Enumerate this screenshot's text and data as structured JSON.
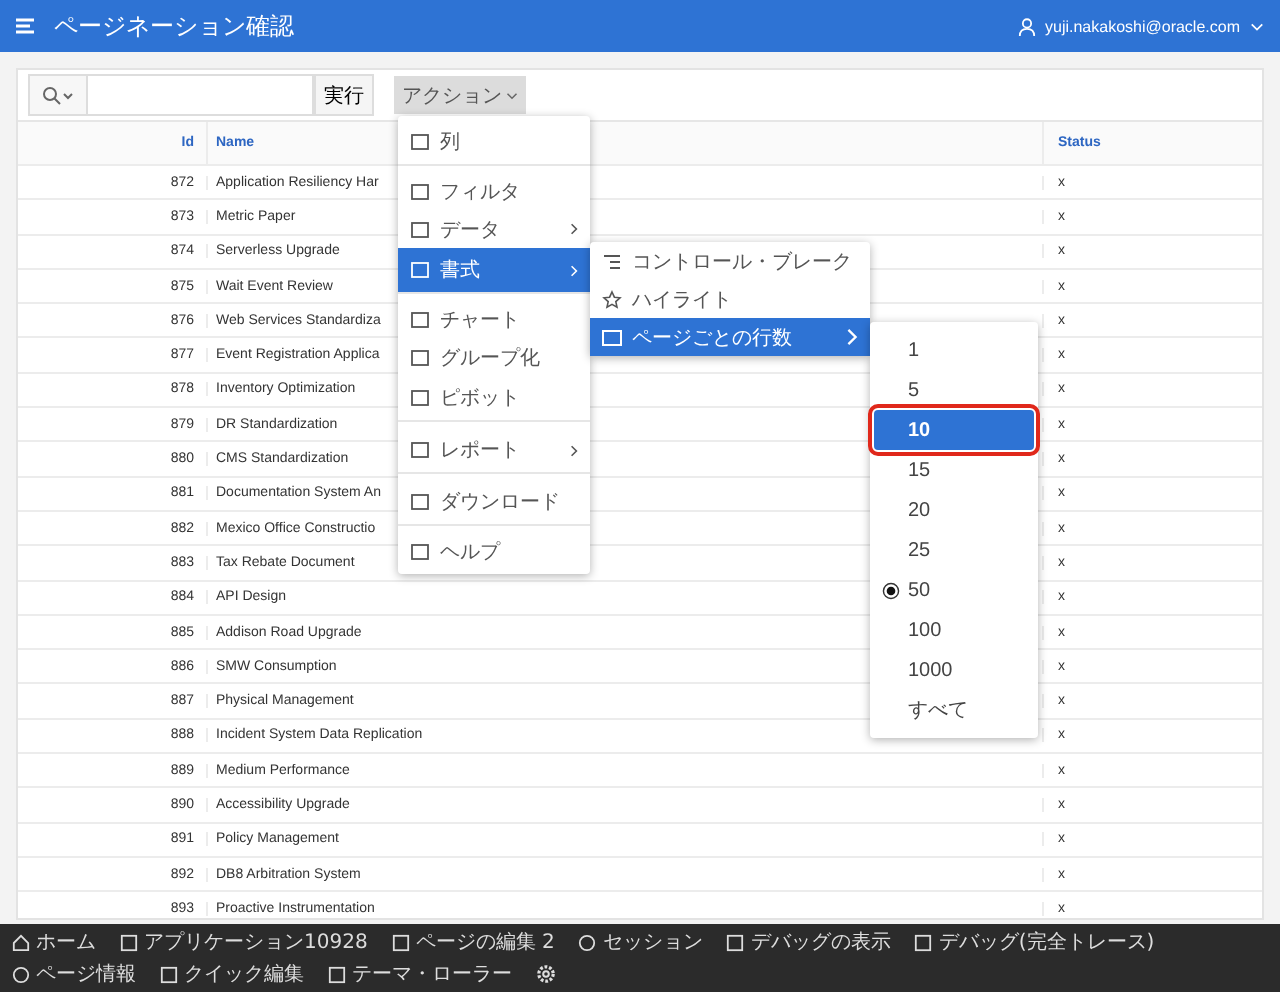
{
  "header": {
    "title": "ページネーション確認",
    "user": "yuji.nakakoshi@oracle.com"
  },
  "toolbar": {
    "go_button": "実行",
    "actions_button": "アクション"
  },
  "table": {
    "columns": [
      "Id",
      "Name",
      "Status"
    ],
    "rows": [
      {
        "id": "872",
        "name": "Application Resiliency Har",
        "status": "x"
      },
      {
        "id": "873",
        "name": "Metric Paper",
        "status": "x"
      },
      {
        "id": "874",
        "name": "Serverless Upgrade",
        "status": "x"
      },
      {
        "id": "875",
        "name": "Wait Event Review",
        "status": "x"
      },
      {
        "id": "876",
        "name": "Web Services Standardiza",
        "status": "x"
      },
      {
        "id": "877",
        "name": "Event Registration Applica",
        "status": "x"
      },
      {
        "id": "878",
        "name": "Inventory Optimization",
        "status": "x"
      },
      {
        "id": "879",
        "name": "DR Standardization",
        "status": "x"
      },
      {
        "id": "880",
        "name": "CMS Standardization",
        "status": "x"
      },
      {
        "id": "881",
        "name": "Documentation System An",
        "status": "x"
      },
      {
        "id": "882",
        "name": "Mexico Office Constructio",
        "status": "x"
      },
      {
        "id": "883",
        "name": "Tax Rebate Document",
        "status": "x"
      },
      {
        "id": "884",
        "name": "API Design",
        "status": "x"
      },
      {
        "id": "885",
        "name": "Addison Road Upgrade",
        "status": "x"
      },
      {
        "id": "886",
        "name": "SMW Consumption",
        "status": "x"
      },
      {
        "id": "887",
        "name": "Physical Management",
        "status": "x"
      },
      {
        "id": "888",
        "name": "Incident System Data Replication",
        "status": "x"
      },
      {
        "id": "889",
        "name": "Medium Performance",
        "status": "x"
      },
      {
        "id": "890",
        "name": "Accessibility Upgrade",
        "status": "x"
      },
      {
        "id": "891",
        "name": "Policy Management",
        "status": "x"
      },
      {
        "id": "892",
        "name": "DB8 Arbitration System",
        "status": "x"
      },
      {
        "id": "893",
        "name": "Proactive Instrumentation",
        "status": "x"
      }
    ]
  },
  "actions_menu": [
    {
      "label": "列",
      "submenu": false,
      "selected": false,
      "divider_after": true
    },
    {
      "label": "フィルタ",
      "submenu": false,
      "selected": false,
      "divider_after": false
    },
    {
      "label": "データ",
      "submenu": true,
      "selected": false,
      "divider_after": false
    },
    {
      "label": "書式",
      "submenu": true,
      "selected": true,
      "divider_after": true
    },
    {
      "label": "チャート",
      "submenu": false,
      "selected": false,
      "divider_after": false
    },
    {
      "label": "グループ化",
      "submenu": false,
      "selected": false,
      "divider_after": false
    },
    {
      "label": "ピボット",
      "submenu": false,
      "selected": false,
      "divider_after": true
    },
    {
      "label": "レポート",
      "submenu": true,
      "selected": false,
      "divider_after": true
    },
    {
      "label": "ダウンロード",
      "submenu": false,
      "selected": false,
      "divider_after": true
    },
    {
      "label": "ヘルプ",
      "submenu": false,
      "selected": false,
      "divider_after": false
    }
  ],
  "format_menu": [
    {
      "label": "コントロール・ブレーク",
      "submenu": false,
      "selected": false
    },
    {
      "label": "ハイライト",
      "submenu": false,
      "selected": false
    },
    {
      "label": "ページごとの行数",
      "submenu": true,
      "selected": true
    }
  ],
  "rows_per_page_menu": [
    {
      "label": "1",
      "selected": false,
      "checked": false,
      "highlighted": false
    },
    {
      "label": "5",
      "selected": false,
      "checked": false,
      "highlighted": false
    },
    {
      "label": "10",
      "selected": true,
      "checked": false,
      "highlighted": true
    },
    {
      "label": "15",
      "selected": false,
      "checked": false,
      "highlighted": false
    },
    {
      "label": "20",
      "selected": false,
      "checked": false,
      "highlighted": false
    },
    {
      "label": "25",
      "selected": false,
      "checked": false,
      "highlighted": false
    },
    {
      "label": "50",
      "selected": false,
      "checked": true,
      "highlighted": false
    },
    {
      "label": "100",
      "selected": false,
      "checked": false,
      "highlighted": false
    },
    {
      "label": "1000",
      "selected": false,
      "checked": false,
      "highlighted": false
    },
    {
      "label": "すべて",
      "selected": false,
      "checked": false,
      "highlighted": false
    }
  ],
  "developer_toolbar": [
    {
      "label": "ホーム"
    },
    {
      "label": "アプリケーション10928"
    },
    {
      "label": "ページの編集 2"
    },
    {
      "label": "セッション"
    },
    {
      "label": "デバッグの表示"
    },
    {
      "label": "デバッグ(完全トレース)"
    },
    {
      "label": "ページ情報"
    },
    {
      "label": "クイック編集"
    },
    {
      "label": "テーマ・ローラー"
    }
  ]
}
